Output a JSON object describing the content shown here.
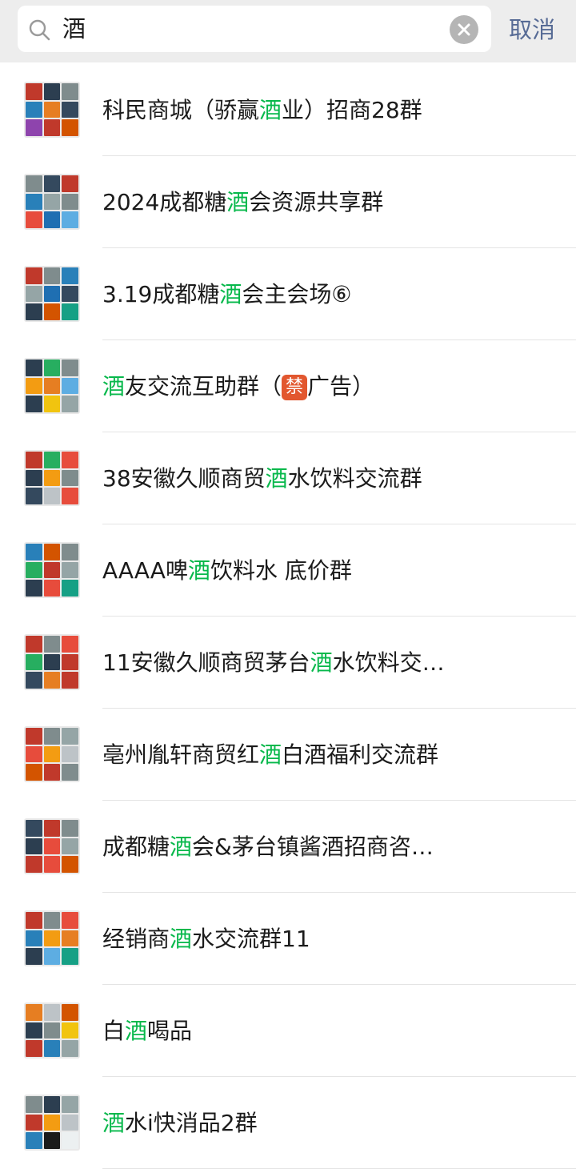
{
  "search": {
    "query": "酒",
    "cancel_label": "取消"
  },
  "results": [
    {
      "parts": [
        "科民商城（骄赢",
        "酒",
        "业）招商28群"
      ],
      "colors": [
        "#c0392b",
        "#2c3e50",
        "#7f8c8d",
        "#2980b9",
        "#e67e22",
        "#34495e",
        "#8e44ad",
        "#c0392b",
        "#d35400"
      ]
    },
    {
      "parts": [
        "2024成都糖",
        "酒",
        "会资源共享群"
      ],
      "colors": [
        "#7f8c8d",
        "#34495e",
        "#c0392b",
        "#2980b9",
        "#95a5a6",
        "#7f8c8d",
        "#e74c3c",
        "#1f6fb2",
        "#5dade2"
      ]
    },
    {
      "parts": [
        "3.19成都糖",
        "酒",
        "会主会场⑥"
      ],
      "colors": [
        "#c0392b",
        "#7f8c8d",
        "#2980b9",
        "#95a5a6",
        "#1f6fb2",
        "#34495e",
        "#2c3e50",
        "#d35400",
        "#16a085"
      ]
    },
    {
      "parts": [
        "",
        "酒",
        "友交流互助群（",
        "禁",
        "广告）"
      ],
      "colors": [
        "#2c3e50",
        "#27ae60",
        "#7f8c8d",
        "#f39c12",
        "#e67e22",
        "#5dade2",
        "#2c3e50",
        "#f1c40f",
        "#95a5a6"
      ]
    },
    {
      "parts": [
        "38安徽久顺商贸",
        "酒",
        "水饮料交流群"
      ],
      "colors": [
        "#c0392b",
        "#27ae60",
        "#e74c3c",
        "#2c3e50",
        "#f39c12",
        "#7f8c8d",
        "#34495e",
        "#bdc3c7",
        "#e74c3c"
      ]
    },
    {
      "parts": [
        "AAAA啤",
        "酒",
        "饮料水   底价群"
      ],
      "colors": [
        "#2980b9",
        "#d35400",
        "#7f8c8d",
        "#27ae60",
        "#c0392b",
        "#95a5a6",
        "#2c3e50",
        "#e74c3c",
        "#16a085"
      ]
    },
    {
      "parts": [
        "11安徽久顺商贸茅台",
        "酒",
        "水饮料交…"
      ],
      "colors": [
        "#c0392b",
        "#7f8c8d",
        "#e74c3c",
        "#27ae60",
        "#2c3e50",
        "#c0392b",
        "#34495e",
        "#e67e22",
        "#c0392b"
      ]
    },
    {
      "parts": [
        "亳州胤轩商贸红",
        "酒",
        "白酒福利交流群"
      ],
      "colors": [
        "#c0392b",
        "#7f8c8d",
        "#95a5a6",
        "#e74c3c",
        "#f39c12",
        "#bdc3c7",
        "#d35400",
        "#c0392b",
        "#7f8c8d"
      ]
    },
    {
      "parts": [
        "成都糖",
        "酒",
        "会&茅台镇酱酒招商咨…"
      ],
      "colors": [
        "#34495e",
        "#c0392b",
        "#7f8c8d",
        "#2c3e50",
        "#e74c3c",
        "#95a5a6",
        "#c0392b",
        "#e74c3c",
        "#d35400"
      ]
    },
    {
      "parts": [
        "经销商",
        "酒",
        "水交流群11"
      ],
      "colors": [
        "#c0392b",
        "#7f8c8d",
        "#e74c3c",
        "#2980b9",
        "#f39c12",
        "#e67e22",
        "#2c3e50",
        "#5dade2",
        "#16a085"
      ]
    },
    {
      "parts": [
        "白",
        "酒",
        "喝品"
      ],
      "colors": [
        "#e67e22",
        "#bdc3c7",
        "#d35400",
        "#2c3e50",
        "#7f8c8d",
        "#f1c40f",
        "#c0392b",
        "#2980b9",
        "#95a5a6"
      ]
    },
    {
      "parts": [
        "",
        "酒",
        "水i快消品2群"
      ],
      "colors": [
        "#7f8c8d",
        "#2c3e50",
        "#95a5a6",
        "#c0392b",
        "#f39c12",
        "#bdc3c7",
        "#2980b9",
        "#1b1b1b",
        "#ecf0f1"
      ]
    }
  ]
}
